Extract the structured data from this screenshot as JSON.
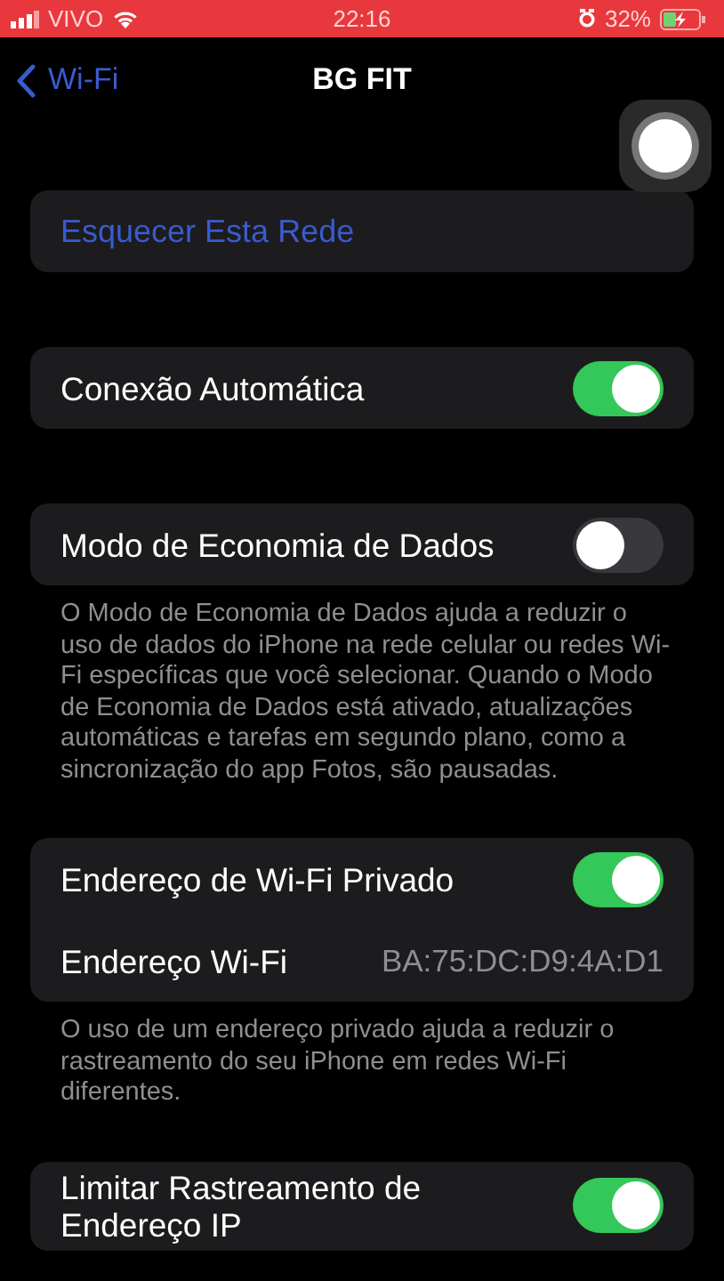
{
  "status_bar": {
    "carrier": "VIVO",
    "time": "22:16",
    "battery": "32%",
    "charging": true
  },
  "nav": {
    "back": "Wi-Fi",
    "title": "BG FIT"
  },
  "groups": [
    {
      "rows": [
        {
          "kind": "action",
          "label": "Esquecer Esta Rede"
        }
      ]
    },
    {
      "rows": [
        {
          "kind": "toggle",
          "label": "Conexão Automática",
          "on": true
        }
      ]
    },
    {
      "rows": [
        {
          "kind": "toggle",
          "label": "Modo de Economia de Dados",
          "on": false
        }
      ],
      "footer": "O Modo de Economia de Dados ajuda a reduzir o uso de dados do iPhone na rede celular ou redes Wi-Fi específicas que você selecionar. Quando o Modo de Economia de Dados está ativado, atualizações automáticas e tarefas em segundo plano, como a sincronização do app Fotos, são pausadas."
    },
    {
      "rows": [
        {
          "kind": "toggle",
          "label": "Endereço de Wi-Fi Privado",
          "on": true
        },
        {
          "kind": "info",
          "label": "Endereço Wi-Fi",
          "value": "BA:75:DC:D9:4A:D1"
        }
      ],
      "footer": "O uso de um endereço privado ajuda a reduzir o rastreamento do seu iPhone em redes Wi-Fi diferentes."
    },
    {
      "rows": [
        {
          "kind": "toggle",
          "label": "Limitar Rastreamento de Endereço IP",
          "on": true
        }
      ]
    }
  ]
}
